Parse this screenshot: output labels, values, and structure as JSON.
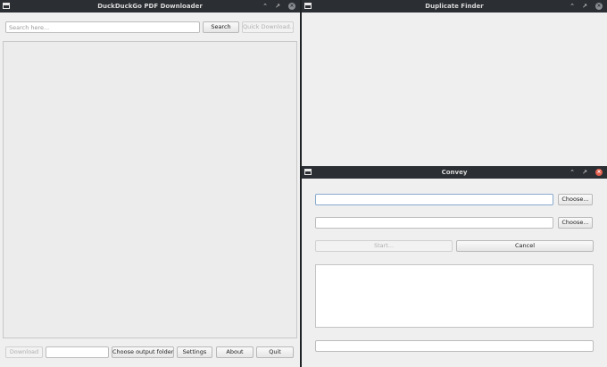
{
  "pdf_window": {
    "title": "DuckDuckGo PDF Downloader",
    "search_placeholder": "Search here...",
    "search_label": "Search",
    "quick_download_label": "Quick Download...",
    "download_label": "Download",
    "download_field_value": "",
    "choose_output_label": "Choose output folder...",
    "settings_label": "Settings",
    "about_label": "About",
    "quit_label": "Quit"
  },
  "dup_window": {
    "title": "Duplicate Finder"
  },
  "convey_window": {
    "title": "Convey",
    "source_value": "",
    "choose1_label": "Choose...",
    "dest_value": "",
    "choose2_label": "Choose...",
    "start_label": "Start...",
    "cancel_label": "Cancel",
    "status_value": ""
  },
  "colors": {
    "titlebar": "#2b2e33",
    "window_bg": "#efefef",
    "close_active": "#e35f4f"
  },
  "icons": [
    "window-icon",
    "minimize-icon",
    "maximize-icon",
    "close-icon"
  ]
}
